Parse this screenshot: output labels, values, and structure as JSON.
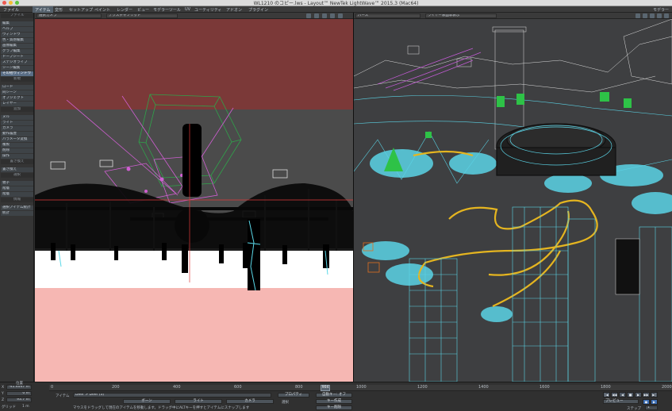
{
  "window": {
    "title": "WL1210 のコピー.lws - Layout™ NewTek LightWave™ 2015.3 (Mac64)"
  },
  "menubar": {
    "items": [
      "ファイル",
      "アイテム",
      "変形",
      "セットアップ",
      "ペイント",
      "レンダー",
      "ビュー",
      "モデラーツール",
      "UV",
      "ユーティリティ",
      "アドオン",
      "プラグイン"
    ],
    "right": "モデラー"
  },
  "sidebar": {
    "rows": [
      {
        "label": "ファイル",
        "kind": "sec"
      },
      {
        "label": "編集",
        "kind": "row"
      },
      {
        "label": "ヘルプ",
        "kind": "row"
      },
      {
        "label": "ウィンドウ",
        "kind": "row"
      },
      {
        "label": "色・質感編集",
        "kind": "row"
      },
      {
        "label": "画像編集",
        "kind": "row"
      },
      {
        "label": "グラフ編集",
        "kind": "row"
      },
      {
        "label": "ドープシート",
        "kind": "row"
      },
      {
        "label": "ステジオライブ",
        "kind": "row"
      },
      {
        "label": "シーン編集",
        "kind": "row"
      },
      {
        "label": "その他ウィンドウ",
        "kind": "hl"
      },
      {
        "label": "新規",
        "kind": "sec"
      },
      {
        "label": "ロード",
        "kind": "row"
      },
      {
        "label": "同シーン",
        "kind": "row"
      },
      {
        "label": "オブジェクト",
        "kind": "row"
      },
      {
        "label": "レイヤー",
        "kind": "row"
      },
      {
        "label": "追加",
        "kind": "sec"
      },
      {
        "label": "ヌル",
        "kind": "row"
      },
      {
        "label": "ライト",
        "kind": "row"
      },
      {
        "label": "カメラ",
        "kind": "row"
      },
      {
        "label": "動作履歴",
        "kind": "row"
      },
      {
        "label": "パラメータ変換",
        "kind": "row"
      },
      {
        "label": "複製",
        "kind": "row"
      },
      {
        "label": "削除",
        "kind": "row"
      },
      {
        "label": "操作",
        "kind": "row"
      },
      {
        "label": "置き換え",
        "kind": "sec"
      },
      {
        "label": "置き換え",
        "kind": "row"
      },
      {
        "label": "選択",
        "kind": "sec"
      },
      {
        "label": "親子",
        "kind": "row"
      },
      {
        "label": "階層",
        "kind": "row"
      },
      {
        "label": "階層",
        "kind": "row"
      },
      {
        "label": "情報",
        "kind": "sec"
      },
      {
        "label": "選択アイテム統計",
        "kind": "row"
      },
      {
        "label": "統計",
        "kind": "row"
      }
    ]
  },
  "viewport_left": {
    "view_mode": "選択カメラ",
    "shading": "テクスチャソリッド"
  },
  "viewport_right": {
    "view_mode": "パース",
    "shading": "ワイヤー表面非表示"
  },
  "timeline": {
    "ticks": [
      "0",
      "200",
      "400",
      "600",
      "800",
      "1000",
      "1200",
      "1400",
      "1600",
      "1800",
      "2000"
    ],
    "current_frame": "904",
    "end_frame": "2000"
  },
  "bottom": {
    "position_label": "位置",
    "x_value": "-41.4047 m",
    "y_value": "0 m",
    "z_value": "93.7 m",
    "grid_label": "グリッド",
    "grid_value": "1 m",
    "item_label": "アイテム",
    "item_value": "Deer > Deer (3)",
    "bones_label": "ボーン",
    "lights_label": "ライト",
    "cameras_label": "カメラ",
    "properties_label": "プロパティ",
    "auto_key_label": "自動キー: オフ",
    "select_label": "選択",
    "create_key": "キー作成",
    "delete_key": "キー削除",
    "preview_label": "プレビュー",
    "step_label": "ステップ",
    "step_value": "1",
    "hint": "マウスをドラッグして現在のアイテムを移動します。ドラッグ中にALTキーを押すとアイテムにスナップします"
  }
}
